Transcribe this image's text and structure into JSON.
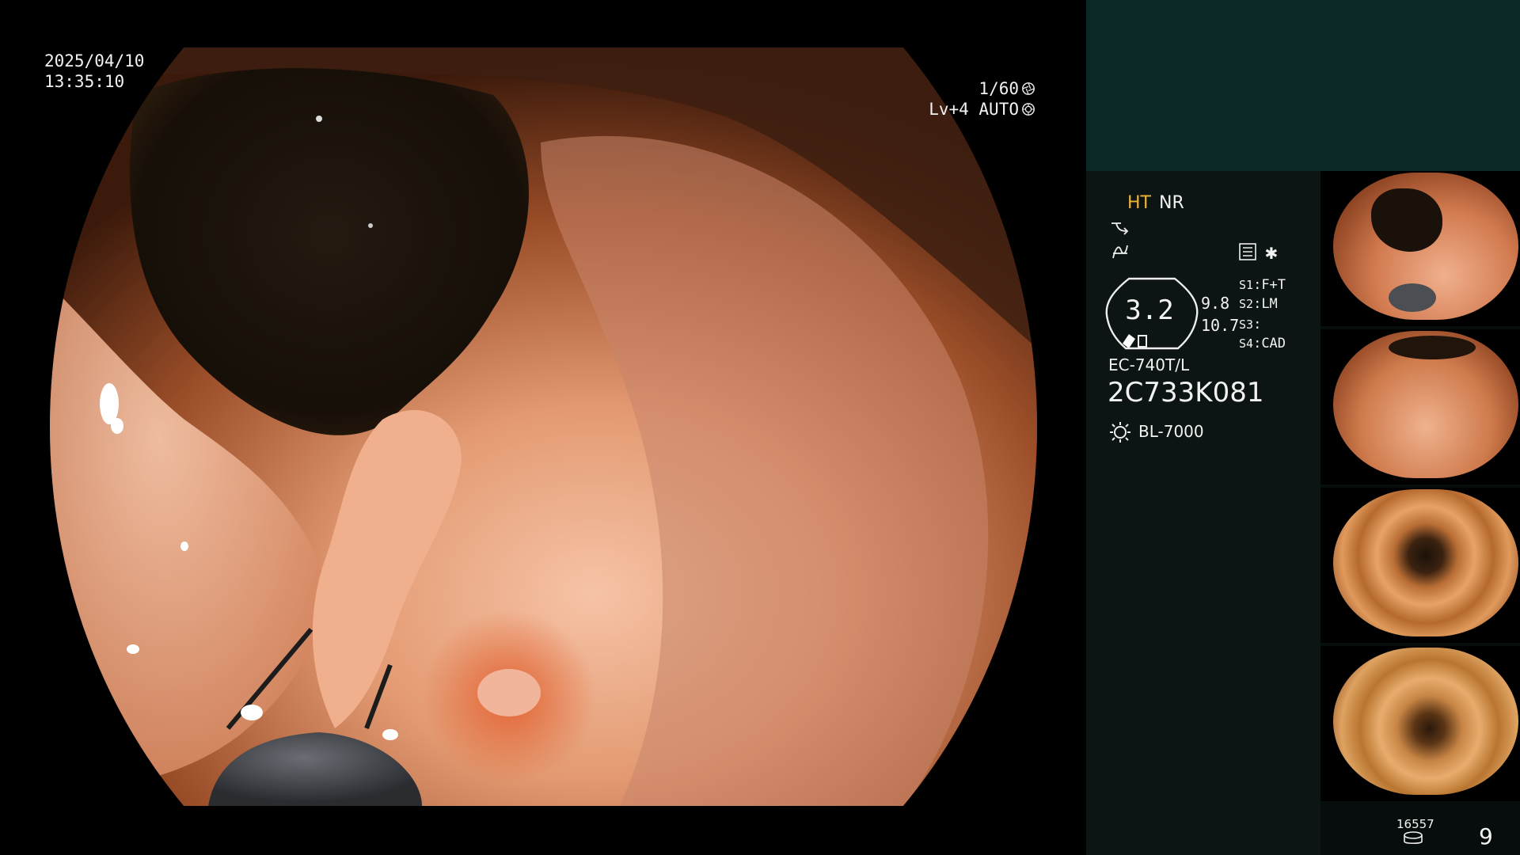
{
  "overlay": {
    "date": "2025/04/10",
    "time": "13:35:10",
    "shutter": "1/60",
    "level": "Lv+4 AUTO"
  },
  "panel": {
    "mode_primary": "HT",
    "mode_secondary": "NR",
    "gauge_value": "3.2",
    "value_top": "9.8",
    "value_bottom": "10.7",
    "slots": [
      {
        "label": "S1",
        "value": "F+T"
      },
      {
        "label": "S2",
        "value": "LM"
      },
      {
        "label": "S3",
        "value": ""
      },
      {
        "label": "S4",
        "value": "CAD"
      }
    ],
    "scope_model": "EC-740T/L",
    "scope_serial": "2C733K081",
    "light_source": "BL-7000",
    "image_count": "16557",
    "page_number": "9"
  },
  "icons": {
    "shutter": "aperture-icon",
    "level": "iris-icon",
    "line1": "enhancement-curve-icon",
    "line2": "structure-enhance-icon",
    "record": "record-settings-icon",
    "star": "star-icon",
    "light": "light-source-icon",
    "disk": "storage-disk-icon"
  },
  "colors": {
    "mode_highlight": "#f0b33a",
    "panel_top": "#0b2827",
    "panel_bg": "#0d1514"
  }
}
